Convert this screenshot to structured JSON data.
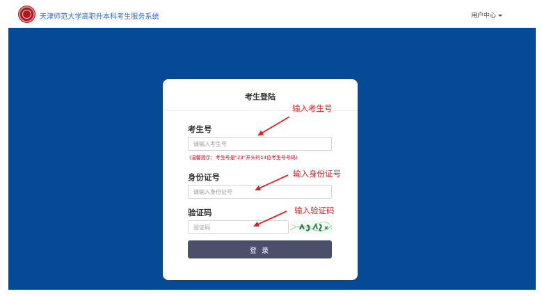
{
  "header": {
    "site_title": "天津师范大学高职升本科考生服务系统",
    "user_center": "用户中心"
  },
  "login": {
    "title": "考生登陆",
    "exam_no_label": "考生号",
    "exam_no_placeholder": "请输入考生号",
    "hint": "(温馨提示：考生号是\"23\"开头的14位考生号号码)",
    "id_label": "身份证号",
    "id_placeholder": "请输入身份证号",
    "captcha_label": "验证码",
    "captcha_placeholder": "验证码",
    "submit": "登 录"
  },
  "annotations": {
    "exam_no": "输入考生号",
    "id": "输入身份证号",
    "captcha": "输入验证码"
  },
  "colors": {
    "band": "#054a94",
    "annotation": "#e02020",
    "button": "#4a506a",
    "title": "#2a6bd1"
  }
}
